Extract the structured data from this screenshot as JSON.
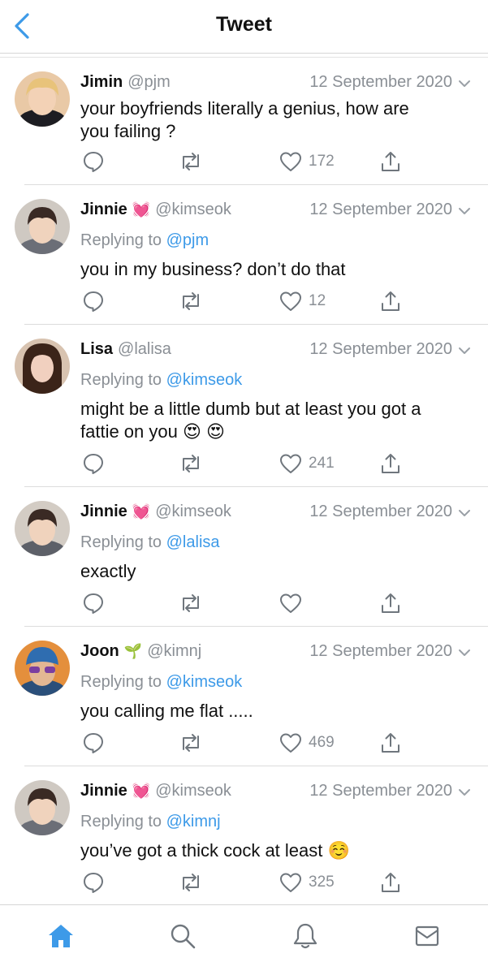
{
  "header": {
    "title": "Tweet"
  },
  "colors": {
    "accent": "#3d9ae8",
    "muted": "#8a8f95",
    "text": "#111111"
  },
  "tweets": [
    {
      "name": "Jimin",
      "name_emoji": "",
      "handle": "@pjm",
      "date": "12 September 2020",
      "replying_prefix": "",
      "replying_to": "",
      "body_line1": "your boyfriends literally a genius, how are",
      "body_line2": "you failing ?",
      "likes": "172"
    },
    {
      "name": "Jinnie",
      "name_emoji": "💓",
      "handle": "@kimseok",
      "date": "12 September 2020",
      "replying_prefix": "Replying to",
      "replying_to": "@pjm",
      "body_line1": "you in my business? don’t do that",
      "body_line2": "",
      "likes": "12"
    },
    {
      "name": "Lisa",
      "name_emoji": "",
      "handle": "@lalisa",
      "date": "12 September 2020",
      "replying_prefix": "Replying to",
      "replying_to": "@kimseok",
      "body_line1": "might be a little dumb but at least you got a",
      "body_line2": "fattie on you 😍 😍",
      "likes": "241"
    },
    {
      "name": "Jinnie",
      "name_emoji": "💓",
      "handle": "@kimseok",
      "date": "12 September 2020",
      "replying_prefix": "Replying to",
      "replying_to": "@lalisa",
      "body_line1": "exactly",
      "body_line2": "",
      "likes": ""
    },
    {
      "name": "Joon",
      "name_emoji": "🌱",
      "handle": "@kimnj",
      "date": "12 September 2020",
      "replying_prefix": "Replying to",
      "replying_to": "@kimseok",
      "body_line1": "you calling me flat .....",
      "body_line2": "",
      "likes": "469"
    },
    {
      "name": "Jinnie",
      "name_emoji": "💓",
      "handle": "@kimseok",
      "date": "12 September 2020",
      "replying_prefix": "Replying to",
      "replying_to": "@kimnj",
      "body_line1": "you’ve got a thick cock at least ☺️",
      "body_line2": "",
      "likes": "325"
    }
  ],
  "icons": {
    "back": "chevron-left-icon",
    "reply": "reply-bubble-icon",
    "retweet": "retweet-icon",
    "like": "heart-icon",
    "share": "share-icon",
    "home": "home-icon",
    "search": "search-icon",
    "notifications": "bell-icon",
    "messages": "mail-icon"
  }
}
